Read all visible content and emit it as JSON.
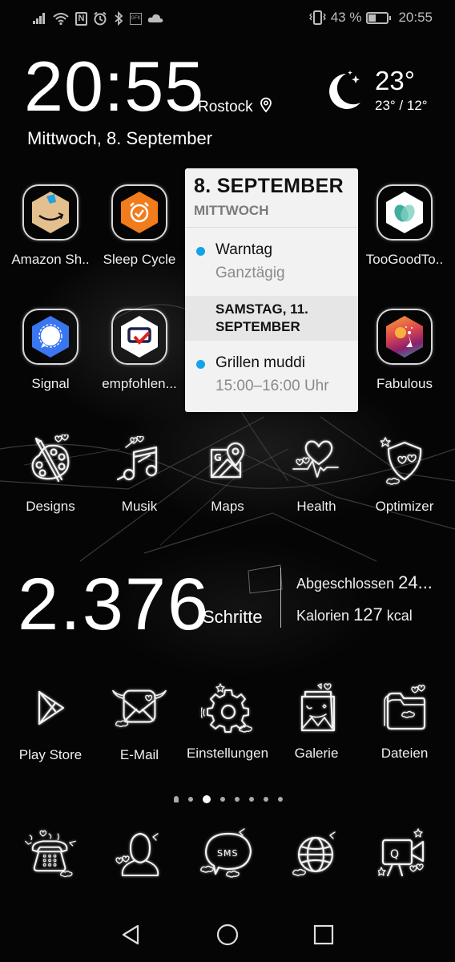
{
  "status_bar": {
    "left_icons": [
      "signal-icon",
      "wifi-icon",
      "nfc-icon",
      "alarm-icon",
      "bluetooth-icon",
      "gfk-icon",
      "cloud-icon"
    ],
    "nfc_glyph": "N",
    "gfk_glyph": "GFK",
    "vibrate_icon": "vibrate-icon",
    "battery_percent_text": "43 %",
    "battery_level": 43,
    "time": "20:55"
  },
  "clock_widget": {
    "time": "20:55",
    "city": "Rostock",
    "date": "Mittwoch, 8. September",
    "weather_icon": "moon-stars-icon",
    "temperature": "23°",
    "range": "23° / 12°"
  },
  "apps_row1": [
    {
      "label": "Amazon Sh..",
      "icon": "amazon-icon"
    },
    {
      "label": "Sleep Cycle",
      "icon": "sleep-cycle-icon"
    },
    {
      "label": "TooGoodTo..",
      "icon": "toogoodtogo-icon"
    }
  ],
  "apps_row2": [
    {
      "label": "Signal",
      "icon": "signal-app-icon"
    },
    {
      "label": "empfohlen...",
      "icon": "empfohlen-icon"
    },
    {
      "label": "Fabulous",
      "icon": "fabulous-icon"
    }
  ],
  "calendar_widget": {
    "title": "8. SEPTEMBER",
    "weekday": "MITTWOCH",
    "events": [
      {
        "title": "Warntag",
        "subtitle": "Ganztägig",
        "color": "#14a3e8"
      }
    ],
    "section": "SAMSTAG, 11. SEPTEMBER",
    "section_events": [
      {
        "title": "Grillen muddi",
        "subtitle": "15:00–16:00 Uhr",
        "color": "#14a3e8"
      }
    ]
  },
  "apps_row3": [
    {
      "label": "Designs",
      "icon": "palette-icon"
    },
    {
      "label": "Musik",
      "icon": "music-note-icon"
    },
    {
      "label": "Maps",
      "icon": "maps-icon"
    },
    {
      "label": "Health",
      "icon": "heart-pulse-icon"
    },
    {
      "label": "Optimizer",
      "icon": "shield-icon"
    }
  ],
  "health_widget": {
    "steps": "2.376",
    "steps_label": "Schritte",
    "completed_label": "Abgeschlossen",
    "completed_value": "24...",
    "calories_label": "Kalorien",
    "calories_value": "127",
    "calories_unit": "kcal"
  },
  "apps_row4": [
    {
      "label": "Play Store",
      "icon": "play-store-icon"
    },
    {
      "label": "E-Mail",
      "icon": "email-icon"
    },
    {
      "label": "Einstellungen",
      "icon": "settings-gear-icon"
    },
    {
      "label": "Galerie",
      "icon": "gallery-icon"
    },
    {
      "label": "Dateien",
      "icon": "folder-icon"
    }
  ],
  "page_indicator": {
    "total_pages": 7,
    "current_page": 2,
    "has_hint_page": true
  },
  "dock": [
    {
      "name": "phone",
      "icon": "phone-icon"
    },
    {
      "name": "contacts",
      "icon": "contacts-icon"
    },
    {
      "name": "messages",
      "icon": "sms-icon",
      "glyph": "SMS"
    },
    {
      "name": "browser",
      "icon": "globe-icon"
    },
    {
      "name": "camera",
      "icon": "camera-icon",
      "glyph": "Q"
    }
  ],
  "nav_bar": {
    "back": "back-icon",
    "home": "home-icon",
    "recents": "recents-icon"
  }
}
